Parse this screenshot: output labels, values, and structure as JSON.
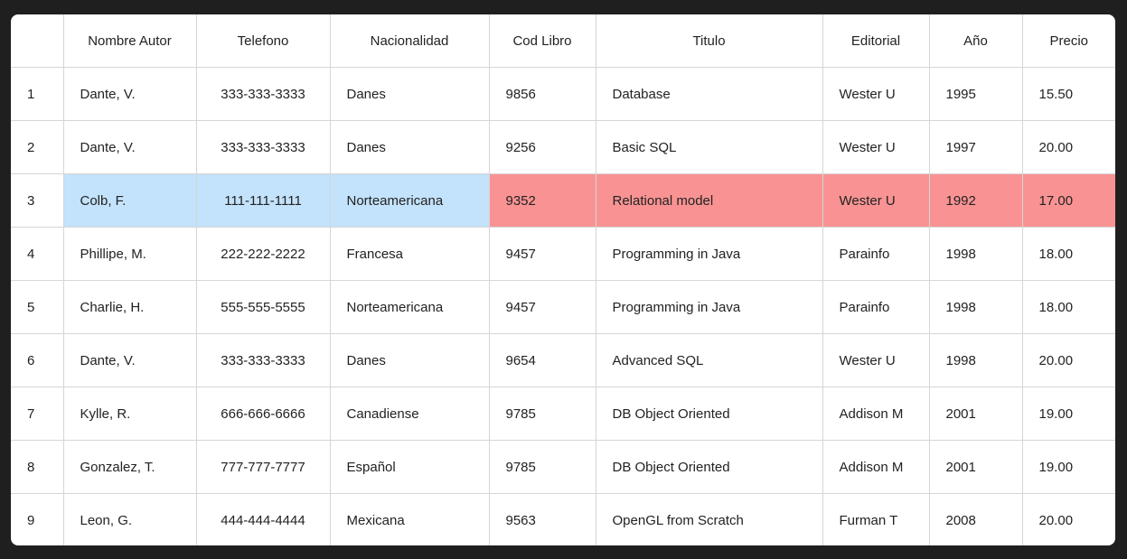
{
  "table": {
    "headers": [
      "",
      "Nombre Autor",
      "Telefono",
      "Nacionalidad",
      "Cod Libro",
      "Titulo",
      "Editorial",
      "Año",
      "Precio"
    ],
    "rows": [
      [
        "1",
        "Dante, V.",
        "333-333-3333",
        "Danes",
        "9856",
        "Database",
        "Wester U",
        "1995",
        "15.50"
      ],
      [
        "2",
        "Dante, V.",
        "333-333-3333",
        "Danes",
        "9256",
        "Basic SQL",
        "Wester U",
        "1997",
        "20.00"
      ],
      [
        "3",
        "Colb, F.",
        "111-111-1111",
        "Norteamericana",
        "9352",
        "Relational model",
        "Wester U",
        "1992",
        "17.00"
      ],
      [
        "4",
        "Phillipe, M.",
        "222-222-2222",
        "Francesa",
        "9457",
        "Programming in Java",
        "Parainfo",
        "1998",
        "18.00"
      ],
      [
        "5",
        "Charlie, H.",
        "555-555-5555",
        "Norteamericana",
        "9457",
        "Programming in Java",
        "Parainfo",
        "1998",
        "18.00"
      ],
      [
        "6",
        "Dante, V.",
        "333-333-3333",
        "Danes",
        "9654",
        "Advanced SQL",
        "Wester U",
        "1998",
        "20.00"
      ],
      [
        "7",
        "Kylle, R.",
        "666-666-6666",
        "Canadiense",
        "9785",
        "DB Object Oriented",
        "Addison M",
        "2001",
        "19.00"
      ],
      [
        "8",
        "Gonzalez, T.",
        "777-777-7777",
        "Español",
        "9785",
        "DB Object Oriented",
        "Addison M",
        "2001",
        "19.00"
      ],
      [
        "9",
        "Leon, G.",
        "444-444-4444",
        "Mexicana",
        "9563",
        "OpenGL from Scratch",
        "Furman T",
        "2008",
        "20.00"
      ]
    ],
    "highlight": {
      "row": "3",
      "author_color": "#c3e2fb",
      "book_color": "#f99393"
    }
  }
}
